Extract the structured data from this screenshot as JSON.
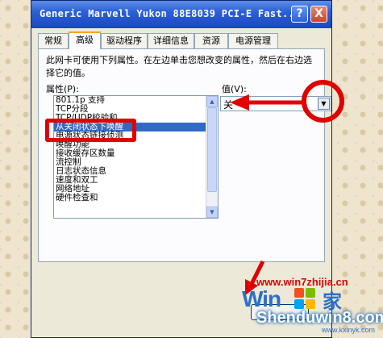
{
  "window": {
    "title": "Generic Marvell Yukon 88E8039 PCI-E Fast...",
    "help_label": "?",
    "close_label": "X"
  },
  "tabs": [
    {
      "label": "常规"
    },
    {
      "label": "高级"
    },
    {
      "label": "驱动程序"
    },
    {
      "label": "详细信息"
    },
    {
      "label": "资源"
    },
    {
      "label": "电源管理"
    }
  ],
  "panel": {
    "description": "此网卡可使用下列属性。在左边单击您想改变的属性，然后在右边选择它的值。",
    "property_label": "属性(P):",
    "value_label": "值(V):"
  },
  "properties": {
    "items": [
      "801.1p 支持",
      "TCP分段",
      "TCP/UDP校验和",
      "从关闭状态下唤醒",
      "电源状态链接侦测",
      "唤醒功能",
      "接收缓存区数量",
      "流控制",
      "日志状态信息",
      "速度和双工",
      "网络地址",
      "硬件检查和"
    ],
    "selected_index": 3,
    "scroll_up_glyph": "▲",
    "scroll_down_glyph": "▼"
  },
  "value": {
    "selected": "关",
    "dropdown_glyph": "▼"
  },
  "watermark": {
    "site": "www.win7zhijia.cn",
    "logo_text": "Win",
    "logo_char": "家",
    "brand": "Shenduwin8.com",
    "domain": "www.kxinyk.com"
  },
  "colors": {
    "annotation": "#e00000",
    "title_bar": "#2b5fd8",
    "selection": "#316ac5"
  }
}
